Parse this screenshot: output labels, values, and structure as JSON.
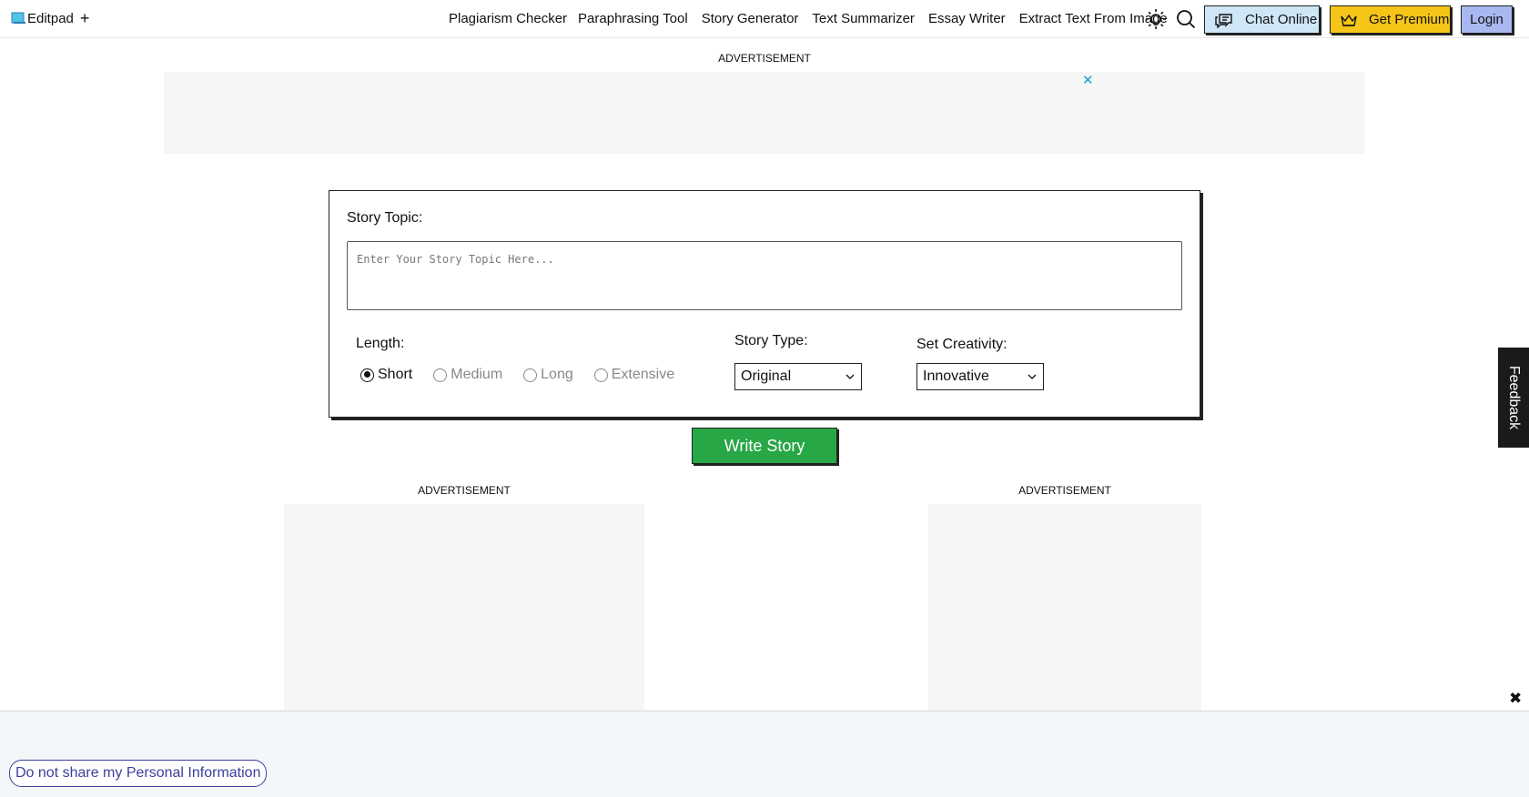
{
  "header": {
    "logo_text": "Editpad",
    "logo_plus": "+",
    "nav": [
      "Plagiarism Checker",
      "Paraphrasing Tool",
      "Story Generator",
      "Text Summarizer",
      "Essay Writer",
      "Extract Text From Image"
    ],
    "chat_label": "Chat Online",
    "premium_label": "Get Premium",
    "login_label": "Login"
  },
  "ads": {
    "label": "ADVERTISEMENT",
    "close": "✕"
  },
  "form": {
    "topic_label": "Story Topic:",
    "topic_placeholder": "Enter Your Story Topic Here...",
    "length_label": "Length:",
    "length_options": [
      {
        "label": "Short",
        "checked": true
      },
      {
        "label": "Medium",
        "checked": false
      },
      {
        "label": "Long",
        "checked": false
      },
      {
        "label": "Extensive",
        "checked": false
      }
    ],
    "story_type_label": "Story Type:",
    "story_type_value": "Original",
    "creativity_label": "Set Creativity:",
    "creativity_value": "Innovative",
    "submit_label": "Write Story"
  },
  "feedback_label": "Feedback",
  "bottom": {
    "close": "✖",
    "privacy_label": "Do not share my Personal Information"
  },
  "colors": {
    "chat_bg": "#cfe6f7",
    "premium_bg": "#f5c518",
    "login_bg": "#a9b8f0",
    "write_bg": "#27a745",
    "privacy": "#3b3f9e"
  }
}
